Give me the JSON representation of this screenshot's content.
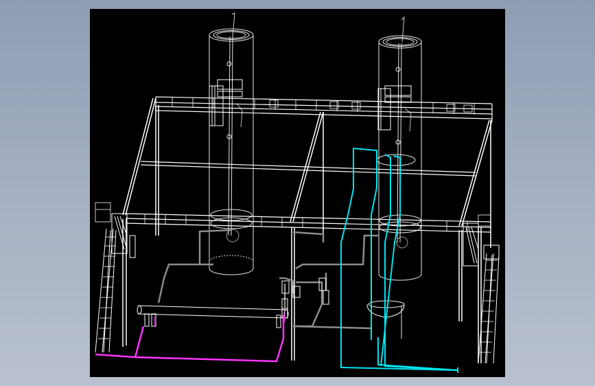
{
  "viewport": {
    "background": "#000000",
    "page_background": "#9aa6bb"
  },
  "colors": {
    "structure_lines": "#ffffff",
    "tower_lines": "#e8e8e8",
    "process_pipe": "#8c8c8c",
    "magenta_pipe": "#ff33ff",
    "cyan_pipe": "#00e5ee"
  },
  "model_parts": [
    "left-column-tower",
    "right-column-tower",
    "upper-platform-deck",
    "middle-frame-level",
    "lower-platform-deck",
    "left-stair",
    "right-stair",
    "horizontal-vessel",
    "magenta-pipeline",
    "cyan-pipeline",
    "gray-process-pipes"
  ]
}
